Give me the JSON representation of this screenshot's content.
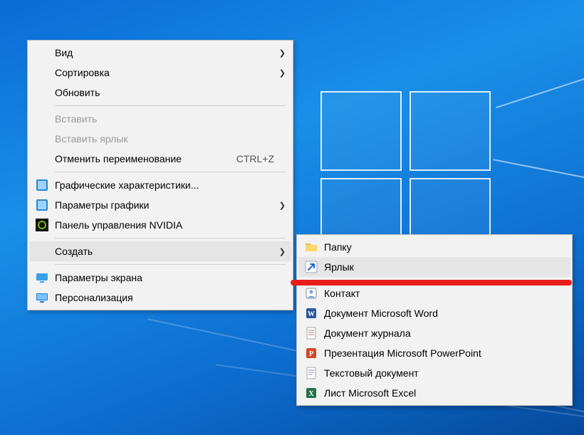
{
  "contextMenu": {
    "view": "Вид",
    "sort": "Сортировка",
    "refresh": "Обновить",
    "paste": "Вставить",
    "pasteShortcut": "Вставить ярлык",
    "undoRename": "Отменить переименование",
    "undoShortcut": "CTRL+Z",
    "intelGfxChar": "Графические характеристики...",
    "intelGfxParams": "Параметры графики",
    "nvidiaPanel": "Панель управления NVIDIA",
    "create": "Создать",
    "displaySettings": "Параметры экрана",
    "personalization": "Персонализация"
  },
  "createSubmenu": {
    "folder": "Папку",
    "shortcut": "Ярлык",
    "contact": "Контакт",
    "wordDoc": "Документ Microsoft Word",
    "journalDoc": "Документ журнала",
    "pptPres": "Презентация Microsoft PowerPoint",
    "textDoc": "Текстовый документ",
    "excelSheet": "Лист Microsoft Excel"
  }
}
